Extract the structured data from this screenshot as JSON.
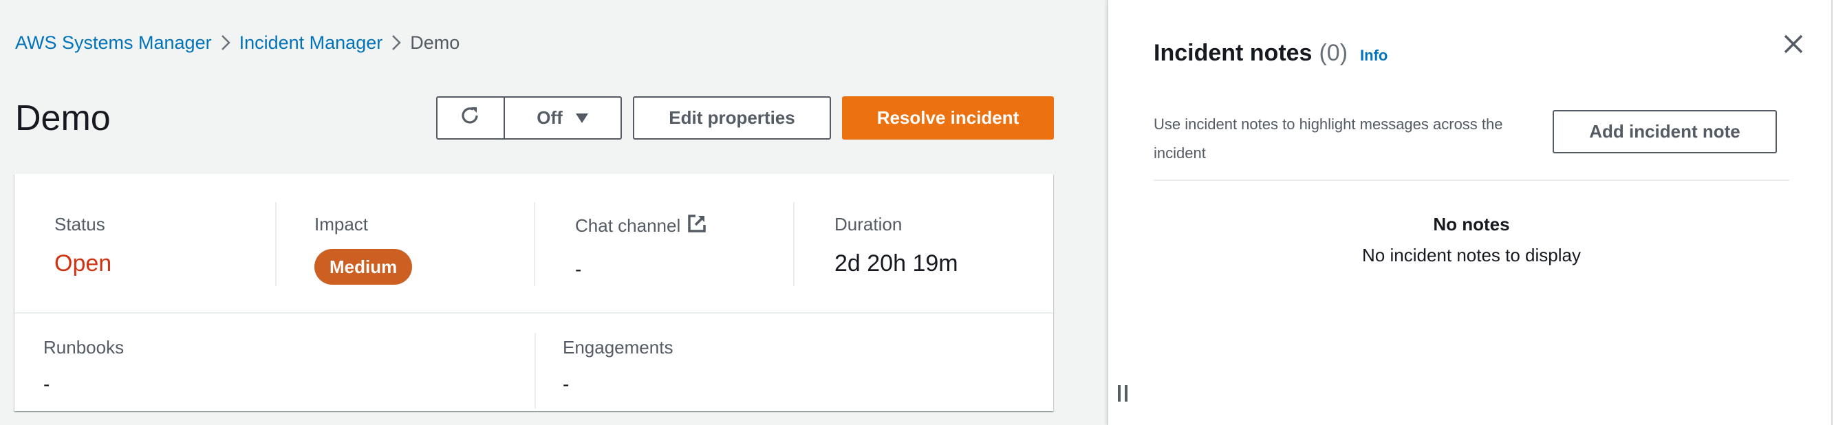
{
  "breadcrumb": {
    "items": [
      {
        "label": "AWS Systems Manager",
        "link": true
      },
      {
        "label": "Incident Manager",
        "link": true
      },
      {
        "label": "Demo",
        "link": false
      }
    ]
  },
  "header": {
    "title": "Demo",
    "actions": {
      "refresh_icon": "refresh-icon",
      "auto_refresh_label": "Off",
      "edit_label": "Edit properties",
      "resolve_label": "Resolve incident"
    }
  },
  "summary": {
    "status": {
      "label": "Status",
      "value": "Open",
      "color": "#d13212"
    },
    "impact": {
      "label": "Impact",
      "value": "Medium",
      "color": "#cc5f21"
    },
    "chat_channel": {
      "label": "Chat channel",
      "icon": "external-link-icon",
      "value": "-"
    },
    "duration": {
      "label": "Duration",
      "value": "2d 20h 19m"
    },
    "runbooks": {
      "label": "Runbooks",
      "value": "-"
    },
    "engagements": {
      "label": "Engagements",
      "value": "-"
    }
  },
  "notes_panel": {
    "title": "Incident notes",
    "count": "(0)",
    "info_label": "Info",
    "description": "Use incident notes to highlight messages across the incident",
    "add_label": "Add incident note",
    "empty_title": "No notes",
    "empty_message": "No incident notes to display"
  },
  "colors": {
    "primary": "#ec7211",
    "link": "#0073bb"
  }
}
